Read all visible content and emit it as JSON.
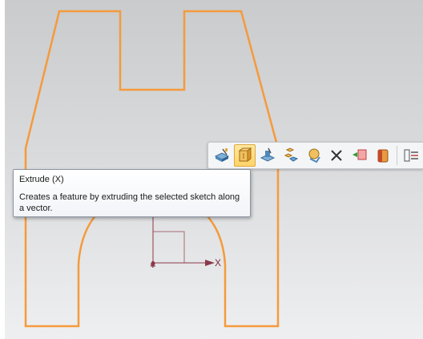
{
  "colors": {
    "sketch": "#f59a3c",
    "axis": "#8a3a4a",
    "toolbar_active": "#ffd46a"
  },
  "toolbar": {
    "items": [
      {
        "name": "sketch-icon",
        "active": false
      },
      {
        "name": "extrude-icon",
        "active": true
      },
      {
        "name": "revolve-icon",
        "active": false
      },
      {
        "name": "edit-sketch-icon",
        "active": false
      },
      {
        "name": "inquiry-icon",
        "active": false
      },
      {
        "name": "delete-icon",
        "active": false
      },
      {
        "name": "move-icon",
        "active": false
      },
      {
        "name": "shaded-icon",
        "active": false
      },
      {
        "name": "menu-icon",
        "active": false
      }
    ]
  },
  "tooltip": {
    "title": "Extrude (X)",
    "description": "Creates a feature by extruding the selected sketch along a vector."
  },
  "axis": {
    "x_label": "X"
  }
}
